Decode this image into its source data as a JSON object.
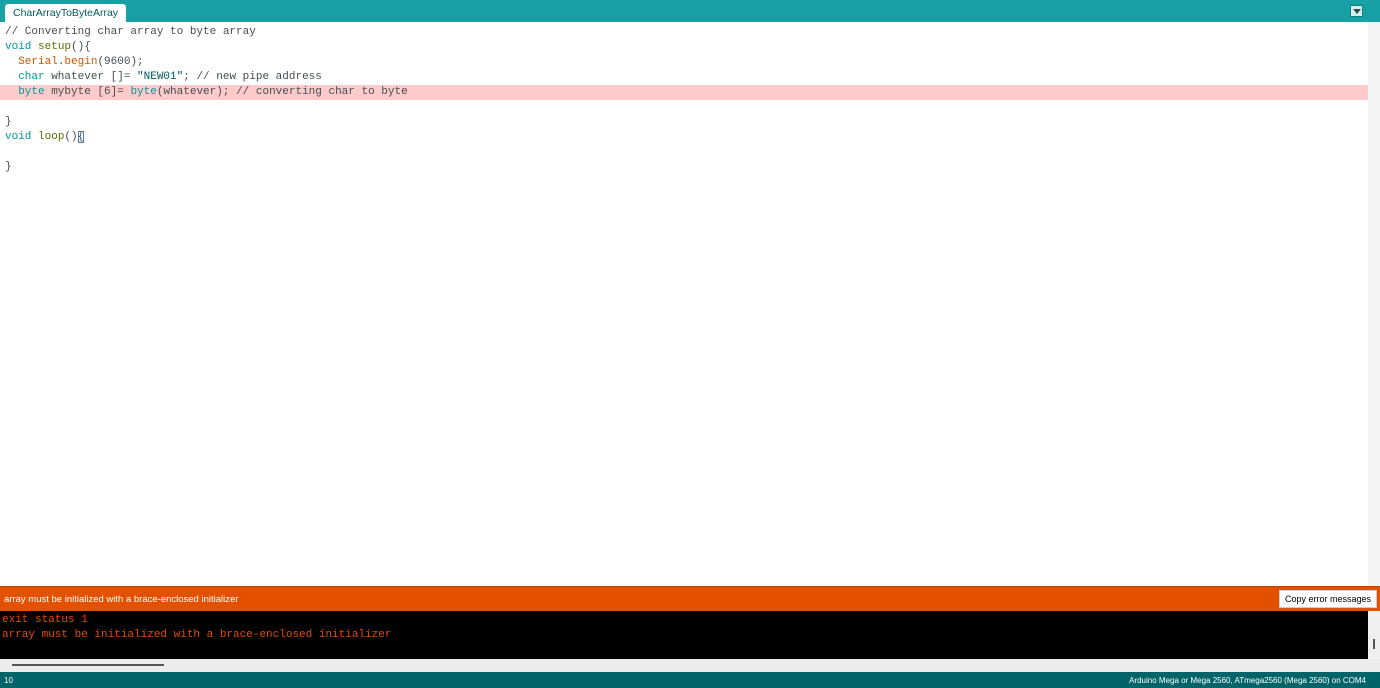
{
  "tab": {
    "title": "CharArrayToByteArray"
  },
  "editor": {
    "lines": [
      "// Converting char array to byte array",
      "void setup(){",
      "  Serial.begin(9600);",
      "  char whatever []= \"NEW01\"; // new pipe address",
      "  byte mybyte [6]= byte(whatever); // converting char to byte",
      "",
      "}",
      "void loop(){",
      "",
      "}"
    ],
    "highlighted_line": 5
  },
  "error_bar": {
    "message": "array must be initialized with a brace-enclosed initializer",
    "copy_button": "Copy error messages"
  },
  "console": {
    "lines": [
      "exit status 1",
      "array must be initialized with a brace-enclosed initializer"
    ]
  },
  "status_bar": {
    "line_number": "10",
    "board": "Arduino Mega or Mega 2560, ATmega2560 (Mega 2560) on COM4"
  },
  "colors": {
    "tab_bar": "#17a1a5",
    "error_bar": "#e35000",
    "highlight": "#ffcaca",
    "status_bar": "#006468",
    "console_text": "#e34c00"
  },
  "icons": {
    "tab_menu": "chevron-down-icon"
  }
}
